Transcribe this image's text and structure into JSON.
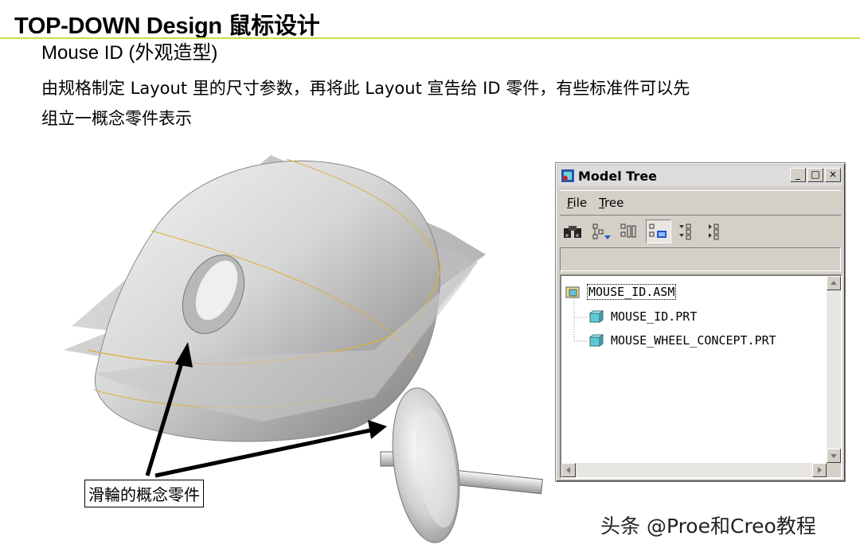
{
  "slide": {
    "title": "TOP-DOWN Design 鼠标设计",
    "subtitle": "Mouse ID (外观造型)",
    "description_line1": "由规格制定 Layout 里的尺寸参数，再将此 Layout 宣告给 ID 零件，有些标准件可以先",
    "description_line2": "组立一概念零件表示",
    "callout": "滑輪的概念零件",
    "watermark": "头条 @Proe和Creo教程",
    "accent_color": "#c7e04a"
  },
  "model_tree": {
    "title": "Model Tree",
    "window_buttons": [
      "_",
      "□",
      "×"
    ],
    "menu": [
      "File",
      "Tree"
    ],
    "toolbar_icons": [
      "find-icon",
      "show-tree-filter-icon",
      "tree-columns-icon",
      "tree-settings-icon",
      "expand-all-icon",
      "collapse-all-icon"
    ],
    "nodes": [
      {
        "label": "MOUSE_ID.ASM",
        "type": "assembly"
      },
      {
        "label": "MOUSE_ID.PRT",
        "type": "part"
      },
      {
        "label": "MOUSE_WHEEL_CONCEPT.PRT",
        "type": "part"
      }
    ]
  }
}
